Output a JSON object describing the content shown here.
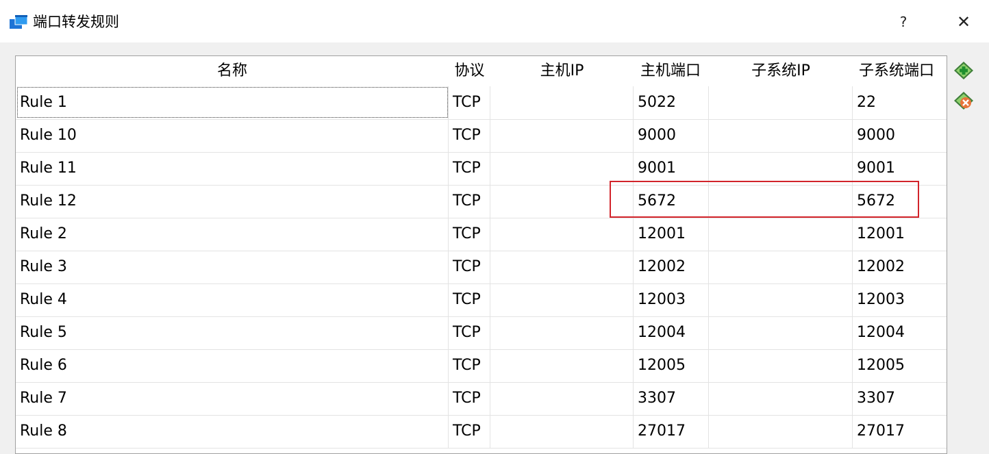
{
  "window": {
    "title": "端口转发规则",
    "help_label": "?",
    "close_label": "✕",
    "icon": "network-window-icon"
  },
  "table": {
    "columns": [
      "名称",
      "协议",
      "主机IP",
      "主机端口",
      "子系统IP",
      "子系统端口"
    ],
    "rows": [
      {
        "name": "Rule 1",
        "protocol": "TCP",
        "host_ip": "",
        "host_port": "5022",
        "sub_ip": "",
        "sub_port": "22"
      },
      {
        "name": "Rule 10",
        "protocol": "TCP",
        "host_ip": "",
        "host_port": "9000",
        "sub_ip": "",
        "sub_port": "9000"
      },
      {
        "name": "Rule 11",
        "protocol": "TCP",
        "host_ip": "",
        "host_port": "9001",
        "sub_ip": "",
        "sub_port": "9001"
      },
      {
        "name": "Rule 12",
        "protocol": "TCP",
        "host_ip": "",
        "host_port": "5672",
        "sub_ip": "",
        "sub_port": "5672"
      },
      {
        "name": "Rule 2",
        "protocol": "TCP",
        "host_ip": "",
        "host_port": "12001",
        "sub_ip": "",
        "sub_port": "12001"
      },
      {
        "name": "Rule 3",
        "protocol": "TCP",
        "host_ip": "",
        "host_port": "12002",
        "sub_ip": "",
        "sub_port": "12002"
      },
      {
        "name": "Rule 4",
        "protocol": "TCP",
        "host_ip": "",
        "host_port": "12003",
        "sub_ip": "",
        "sub_port": "12003"
      },
      {
        "name": "Rule 5",
        "protocol": "TCP",
        "host_ip": "",
        "host_port": "12004",
        "sub_ip": "",
        "sub_port": "12004"
      },
      {
        "name": "Rule 6",
        "protocol": "TCP",
        "host_ip": "",
        "host_port": "12005",
        "sub_ip": "",
        "sub_port": "12005"
      },
      {
        "name": "Rule 7",
        "protocol": "TCP",
        "host_ip": "",
        "host_port": "3307",
        "sub_ip": "",
        "sub_port": "3307"
      },
      {
        "name": "Rule 8",
        "protocol": "TCP",
        "host_ip": "",
        "host_port": "27017",
        "sub_ip": "",
        "sub_port": "27017"
      }
    ]
  },
  "toolbar": {
    "add_icon": "add-rule-icon",
    "remove_icon": "remove-rule-icon"
  },
  "annotation": {
    "highlight_color": "#d2232a"
  }
}
